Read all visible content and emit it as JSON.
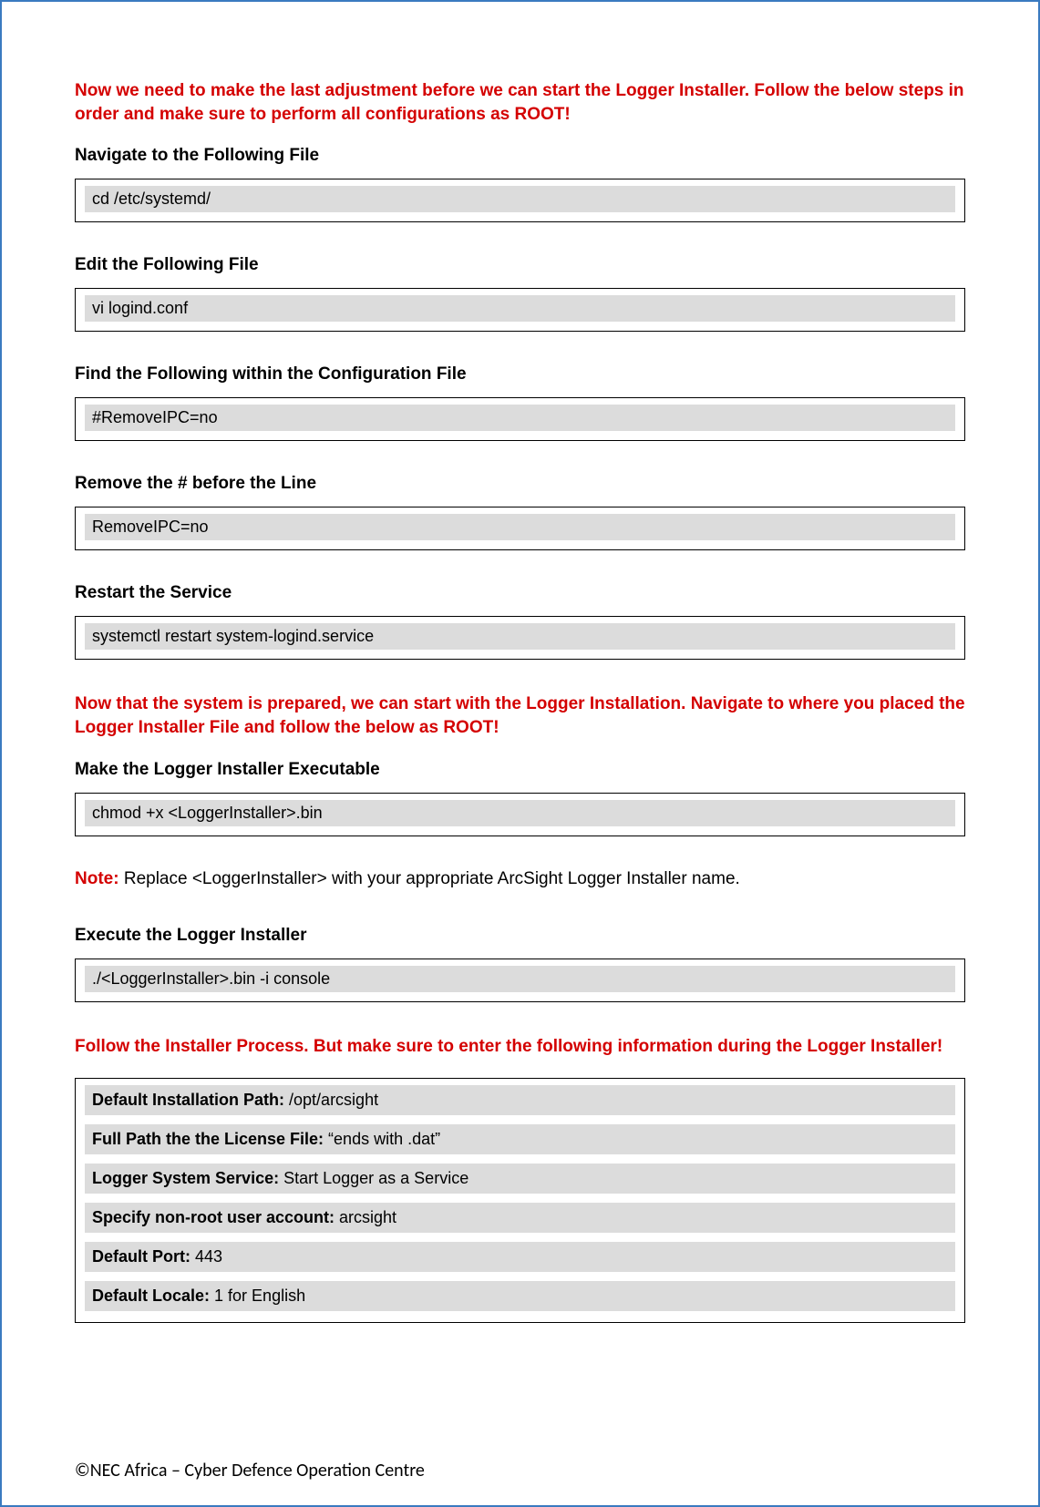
{
  "intro": "Now we need to make the last adjustment before we can start the Logger Installer. Follow the below steps in order and make sure to perform all configurations as ROOT!",
  "steps": [
    {
      "heading": "Navigate to the Following File",
      "code": "cd /etc/systemd/"
    },
    {
      "heading": "Edit the Following File",
      "code": "vi logind.conf"
    },
    {
      "heading": "Find the Following within the Configuration File",
      "code": "#RemoveIPC=no"
    },
    {
      "heading": "Remove the # before the Line",
      "code": "RemoveIPC=no"
    },
    {
      "heading": "Restart the Service",
      "code": "systemctl restart system-logind.service"
    }
  ],
  "mid_warn": "Now that the system is prepared, we can start with the Logger Installation. Navigate to where you placed the Logger Installer File and follow the below as ROOT!",
  "exec_heading": "Make the Logger Installer Executable",
  "exec_code": "chmod +x <LoggerInstaller>.bin",
  "note_label": "Note:",
  "note_text": " Replace <LoggerInstaller> with your appropriate ArcSight Logger Installer name.",
  "run_heading": "Execute the Logger Installer",
  "run_code": "./<LoggerInstaller>.bin -i console",
  "final_warn": "Follow the Installer Process. But make sure to enter the following information during the Logger Installer!",
  "install_info": [
    {
      "key": "Default Installation Path: ",
      "val": "/opt/arcsight"
    },
    {
      "key": "Full Path the the License File: ",
      "val": "“ends with .dat”"
    },
    {
      "key": "Logger System Service: ",
      "val": "Start Logger as a Service"
    },
    {
      "key": "Specify non-root user account: ",
      "val": "arcsight"
    },
    {
      "key": "Default Port: ",
      "val": "443"
    },
    {
      "key": "Default Locale: ",
      "val": "1 for English"
    }
  ],
  "footer": "©NEC Africa – Cyber Defence Operation Centre"
}
